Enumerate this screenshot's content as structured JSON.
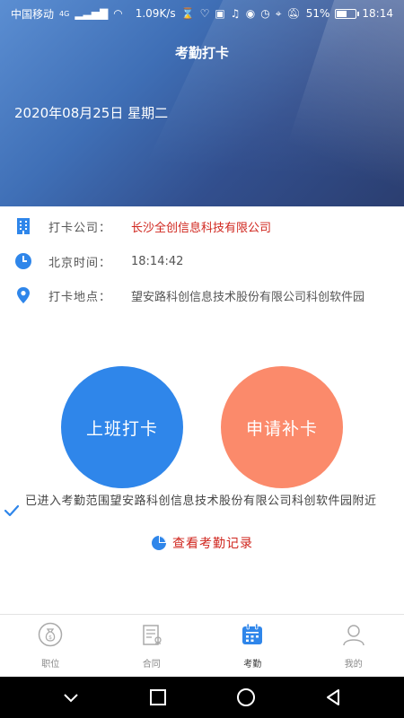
{
  "status_bar": {
    "carrier": "中国移动",
    "network": "4G",
    "speed": "1.09K/s",
    "battery": "51%",
    "time": "18:14"
  },
  "header": {
    "title": "考勤打卡",
    "date": "2020年08月25日 星期二"
  },
  "info": {
    "company_label": "打卡公司：",
    "company_value": "长沙全创信息科技有限公司",
    "time_label": "北京时间：",
    "time_value": "18:14:42",
    "location_label": "打卡地点：",
    "location_value": "望安路科创信息技术股份有限公司科创软件园"
  },
  "actions": {
    "clock_in": "上班打卡",
    "apply_makeup": "申请补卡"
  },
  "range_notice": "已进入考勤范围望安路科创信息技术股份有限公司科创软件园附近",
  "records_link": "查看考勤记录",
  "tabs": [
    {
      "label": "职位",
      "icon": "moneybag-icon"
    },
    {
      "label": "合同",
      "icon": "contract-icon"
    },
    {
      "label": "考勤",
      "icon": "calendar-icon"
    },
    {
      "label": "我的",
      "icon": "user-icon"
    }
  ],
  "colors": {
    "accent_blue": "#2f86ea",
    "accent_orange": "#fb8a6b",
    "text_red": "#d0261e"
  }
}
